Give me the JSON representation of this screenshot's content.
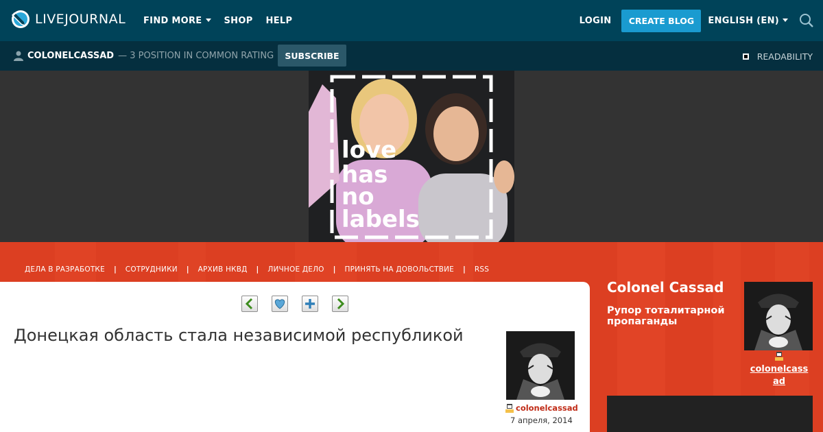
{
  "header": {
    "logo_text": "LIVEJOURNAL",
    "nav": [
      {
        "label": "FIND MORE",
        "dropdown": true
      },
      {
        "label": "SHOP",
        "dropdown": false
      },
      {
        "label": "HELP",
        "dropdown": false
      }
    ],
    "login_label": "LOGIN",
    "create_blog_label": "CREATE BLOG",
    "language_label": "ENGLISH (EN)",
    "bg_color": "#004359",
    "accent_color": "#1a9bd0"
  },
  "subheader": {
    "username": "COLONELCASSAD",
    "rating": "— 3 POSITION IN COMMON RATING",
    "subscribe_label": "SUBSCRIBE",
    "readability_label": "READABILITY"
  },
  "banner": {
    "image_text_lines": [
      "love",
      "has",
      "no",
      "labels"
    ]
  },
  "journal_menu": {
    "items": [
      "ДЕЛА В РАЗРАБОТКЕ",
      "СОТРУДНИКИ",
      "АРХИВ НКВД",
      "ЛИЧНОЕ ДЕЛО",
      "ПРИНЯТЬ НА ДОВОЛЬСТВИЕ",
      "RSS"
    ],
    "separator": "|",
    "bg_color": "#dc3f22"
  },
  "post": {
    "controls": [
      "prev-entry-icon",
      "heart-icon",
      "add-icon",
      "next-entry-icon"
    ],
    "title": "Донецкая область стала независимой республикой",
    "author": "colonelcassad",
    "date": "7 апреля, 2014"
  },
  "sidebar": {
    "title": "Colonel Cassad",
    "description": "Рупор тоталитарной пропаганды",
    "username_line1": "colonelcass",
    "username_line2": "ad"
  }
}
